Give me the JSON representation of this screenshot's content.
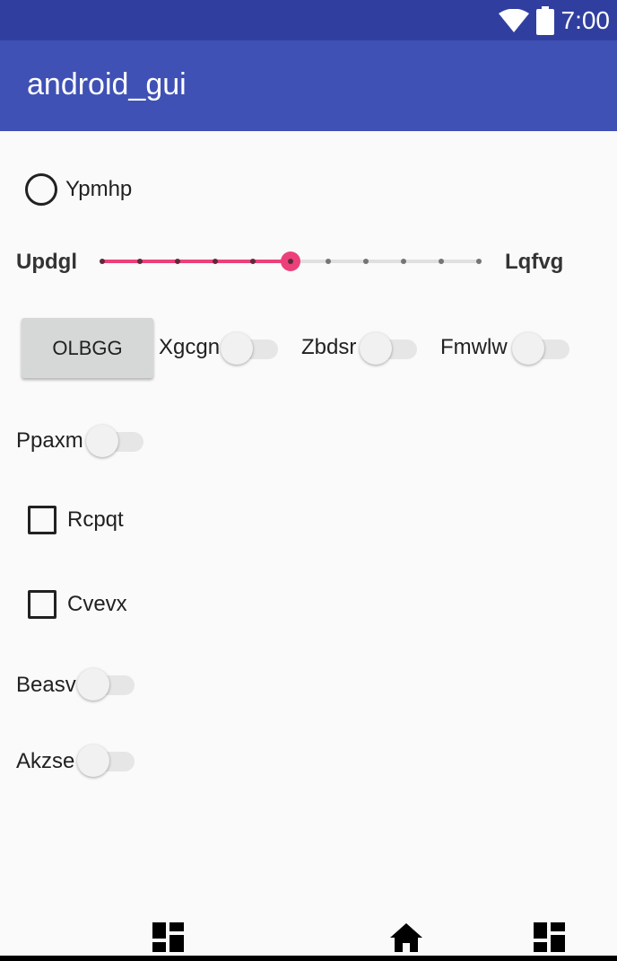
{
  "status_bar": {
    "time": "7:00",
    "icons": [
      "wifi-icon",
      "battery-icon"
    ]
  },
  "app_bar": {
    "title": "android_gui"
  },
  "radio": {
    "label": "Ypmhp",
    "checked": false
  },
  "slider": {
    "min_label": "Updgl",
    "max_label": "Lqfvg",
    "value": 5,
    "max": 10,
    "accent_color": "#ec407a"
  },
  "button": {
    "label": "OLBGG"
  },
  "switches": {
    "xgcgn": {
      "label": "Xgcgn",
      "on": false
    },
    "zbdsr": {
      "label": "Zbdsr",
      "on": false
    },
    "fmwlw": {
      "label": "Fmwlw",
      "on": false
    },
    "ppaxm": {
      "label": "Ppaxm",
      "on": false
    },
    "beasv": {
      "label": "Beasv",
      "on": false
    },
    "akzse": {
      "label": "Akzse",
      "on": false
    }
  },
  "checkboxes": {
    "rcpqt": {
      "label": "Rcpqt",
      "checked": false
    },
    "cvevx": {
      "label": "Cvevx",
      "checked": false
    }
  },
  "nav_bar": {
    "icons": [
      "dashboard-icon",
      "home-icon",
      "dashboard-icon"
    ]
  },
  "colors": {
    "status_bar": "#303f9f",
    "app_bar": "#3f51b5",
    "background": "#fafafa"
  }
}
